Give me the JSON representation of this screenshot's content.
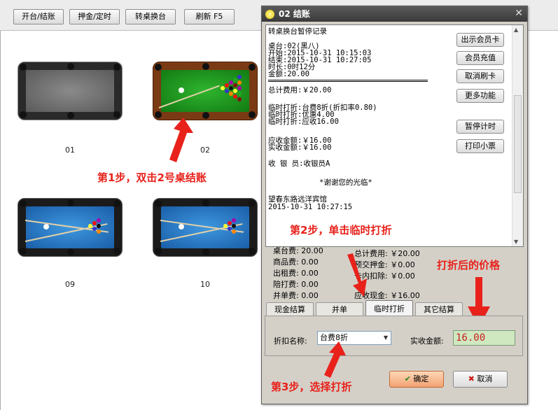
{
  "toolbar": {
    "btn_open": "开台/结账",
    "btn_deposit": "押金/定时",
    "btn_switch": "转桌换台",
    "btn_refresh": "刷新 F5"
  },
  "tables": {
    "t01": "01",
    "t02": "02",
    "t09": "09",
    "t10": "10"
  },
  "annotations": {
    "step1": "第1步，双击2号桌结账",
    "step2": "第2步，单击临时打折",
    "step3": "第3步，选择打折",
    "price_note": "打折后的价格"
  },
  "dialog": {
    "title": "02 结账",
    "receipt": {
      "l1": "转桌换台暂停记录",
      "l2": "桌台:02(黑八)",
      "l3": "开始:2015-10-31 10:15:03",
      "l4": "结束:2015-10-31 10:27:05",
      "l5": "时长:0时12分",
      "l6": "金额:20.00",
      "l7": "总计费用:￥20.00",
      "l8": "临时打折:台费8折(折扣率0.80)",
      "l9": "临时打折:优惠4.00",
      "l10": "临时打折:应收16.00",
      "l11": "应收金额:￥16.00",
      "l12": "实收金额:￥16.00",
      "l13": "收 银 员:收银员A",
      "l14": "*谢谢您的光临*",
      "l15": "望春东路远洋宾馆",
      "l16": "2015-10-31 10:27:15"
    },
    "side_buttons": {
      "b1": "出示会员卡",
      "b2": "会员充值",
      "b3": "取消刷卡",
      "b4": "更多功能",
      "b5": "暂停计时",
      "b6": "打印小票"
    },
    "summary": {
      "table_fee": "桌台费: 20.00",
      "goods_fee": "商品费: 0.00",
      "rent_fee": "出租费: 0.00",
      "accomp_fee": "陪打费: 0.00",
      "merge_fee": "并单费: 0.00",
      "total_fee": "总计费用: ￥20.00",
      "prepaid": "预交押金: ￥0.00",
      "card_deduct": "卡内扣除: ￥0.00",
      "cash_due": "应收现金: ￥16.00"
    },
    "tabs": {
      "t1": "现金结算",
      "t2": "并单",
      "t3": "临时打折",
      "t4": "其它结算"
    },
    "discount": {
      "label": "折扣名称:",
      "value": "台费8折",
      "amount_label": "实收金额:",
      "amount": "16.00"
    },
    "footer": {
      "ok": "确定",
      "cancel": "取消"
    }
  }
}
